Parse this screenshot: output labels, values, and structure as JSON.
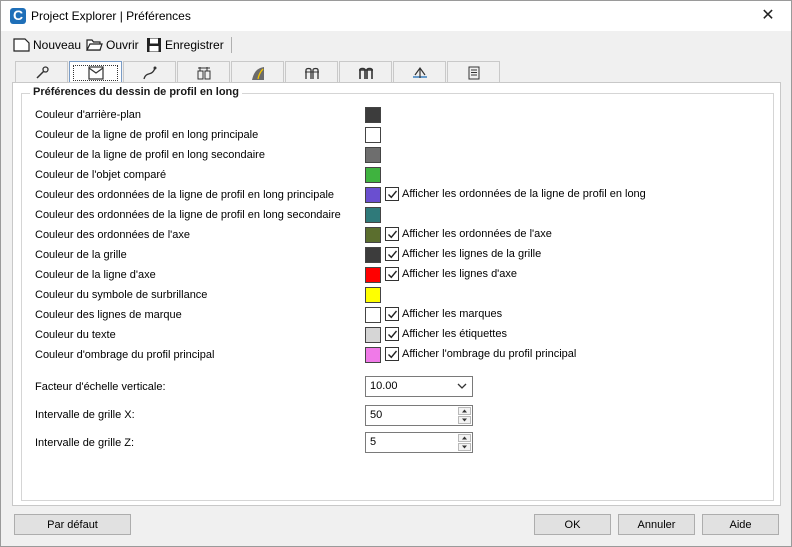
{
  "window": {
    "title": "Project Explorer | Préférences",
    "close_glyph": "✕"
  },
  "toolbar": {
    "new_label": "Nouveau",
    "open_label": "Ouvrir",
    "save_label": "Enregistrer"
  },
  "tabs": [
    {
      "icon": "wrench-icon"
    },
    {
      "icon": "profile-view-icon",
      "active": true
    },
    {
      "icon": "alignment-curve-icon"
    },
    {
      "icon": "structure-icon"
    },
    {
      "icon": "road-icon"
    },
    {
      "icon": "culvert-icon"
    },
    {
      "icon": "culvert-alt-icon"
    },
    {
      "icon": "axis-icon"
    },
    {
      "icon": "list-icon"
    }
  ],
  "group": {
    "title": "Préférences du dessin de profil en long"
  },
  "color_rows": [
    {
      "label": "Couleur d'arrière-plan",
      "color": "#3c3c3c",
      "check": null
    },
    {
      "label": "Couleur de la ligne de profil en long principale",
      "color": "#ffffff",
      "check": null
    },
    {
      "label": "Couleur de la ligne de profil en long secondaire",
      "color": "#6e6e6e",
      "check": null
    },
    {
      "label": "Couleur de l'objet comparé",
      "color": "#3fb33f",
      "check": null
    },
    {
      "label": "Couleur des ordonnées de la ligne de profil en long principale",
      "color": "#6a4fd0",
      "check": "Afficher les ordonnées de la ligne de profil en long"
    },
    {
      "label": "Couleur des ordonnées de la ligne de profil en long secondaire",
      "color": "#2f7a7a",
      "check": null
    },
    {
      "label": "Couleur des ordonnées de l'axe",
      "color": "#5b6e2e",
      "check": "Afficher les ordonnées de l'axe"
    },
    {
      "label": "Couleur de la grille",
      "color": "#3c3c3c",
      "check": "Afficher les lignes de la grille"
    },
    {
      "label": "Couleur de la ligne d'axe",
      "color": "#ff0000",
      "check": "Afficher les lignes d'axe"
    },
    {
      "label": "Couleur du symbole de surbrillance",
      "color": "#ffff00",
      "check": null
    },
    {
      "label": "Couleur des lignes de marque",
      "color": "#ffffff",
      "check": "Afficher les marques"
    },
    {
      "label": "Couleur du texte",
      "color": "#d6d6d6",
      "check": "Afficher les étiquettes"
    },
    {
      "label": "Couleur d'ombrage du profil principal",
      "color": "#f07ae8",
      "check": "Afficher l'ombrage du profil principal"
    }
  ],
  "fields": {
    "scale_label": "Facteur d'échelle verticale:",
    "scale_value": "10.00",
    "grid_x_label": "Intervalle de grille X:",
    "grid_x_value": "50",
    "grid_z_label": "Intervalle de grille Z:",
    "grid_z_value": "5"
  },
  "buttons": {
    "default": "Par défaut",
    "ok": "OK",
    "cancel": "Annuler",
    "help": "Aide"
  }
}
